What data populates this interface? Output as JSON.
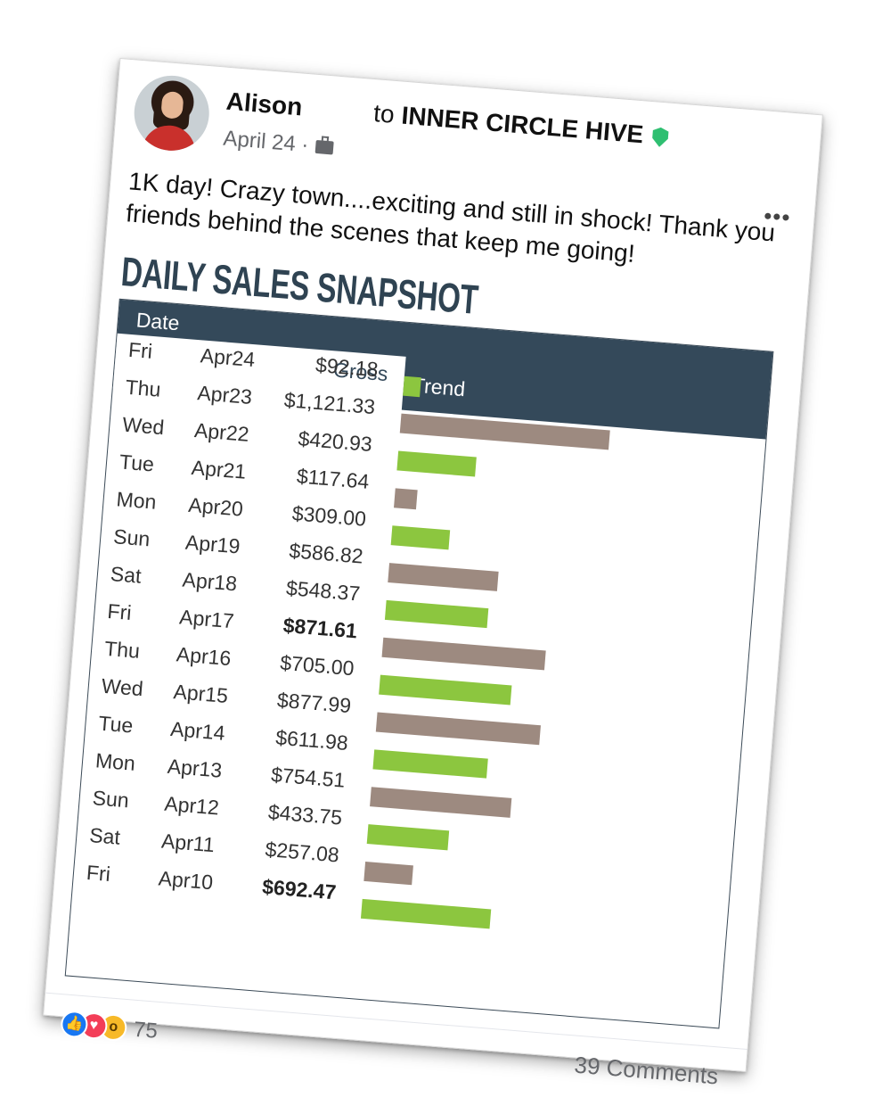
{
  "post": {
    "author": "Alison",
    "to_prefix": "to",
    "group": "INNER CIRCLE HIVE",
    "date": "April 24 ·",
    "more": "•••",
    "text": "1K day! Crazy town....exciting and still in shock! Thank you friends behind the scenes that keep me going!"
  },
  "snapshot": {
    "title": "DAILY SALES SNAPSHOT",
    "headers": {
      "date": "Date",
      "gross": "Gross",
      "trend": "Trend"
    }
  },
  "colors": {
    "header_bg": "#34495a",
    "bar_green": "#8cc63f",
    "bar_taupe": "#9d8a80"
  },
  "rows": [
    {
      "day": "Fri",
      "date": "Apr24",
      "gross": "$92.18",
      "trend": 92.18,
      "bold": false
    },
    {
      "day": "Thu",
      "date": "Apr23",
      "gross": "$1,121.33",
      "trend": 1121.33,
      "bold": false
    },
    {
      "day": "Wed",
      "date": "Apr22",
      "gross": "$420.93",
      "trend": 420.93,
      "bold": false
    },
    {
      "day": "Tue",
      "date": "Apr21",
      "gross": "$117.64",
      "trend": 117.64,
      "bold": false
    },
    {
      "day": "Mon",
      "date": "Apr20",
      "gross": "$309.00",
      "trend": 309.0,
      "bold": false
    },
    {
      "day": "Sun",
      "date": "Apr19",
      "gross": "$586.82",
      "trend": 586.82,
      "bold": false
    },
    {
      "day": "Sat",
      "date": "Apr18",
      "gross": "$548.37",
      "trend": 548.37,
      "bold": false
    },
    {
      "day": "Fri",
      "date": "Apr17",
      "gross": "$871.61",
      "trend": 871.61,
      "bold": true
    },
    {
      "day": "Thu",
      "date": "Apr16",
      "gross": "$705.00",
      "trend": 705.0,
      "bold": false
    },
    {
      "day": "Wed",
      "date": "Apr15",
      "gross": "$877.99",
      "trend": 877.99,
      "bold": false
    },
    {
      "day": "Tue",
      "date": "Apr14",
      "gross": "$611.98",
      "trend": 611.98,
      "bold": false
    },
    {
      "day": "Mon",
      "date": "Apr13",
      "gross": "$754.51",
      "trend": 754.51,
      "bold": false
    },
    {
      "day": "Sun",
      "date": "Apr12",
      "gross": "$433.75",
      "trend": 433.75,
      "bold": false
    },
    {
      "day": "Sat",
      "date": "Apr11",
      "gross": "$257.08",
      "trend": 257.08,
      "bold": false
    },
    {
      "day": "Fri",
      "date": "Apr10",
      "gross": "$692.47",
      "trend": 692.47,
      "bold": true
    }
  ],
  "footer": {
    "reaction_count": "75",
    "reactions": [
      "like-icon",
      "love-icon",
      "wow-icon"
    ],
    "comments": "39 Comments"
  }
}
